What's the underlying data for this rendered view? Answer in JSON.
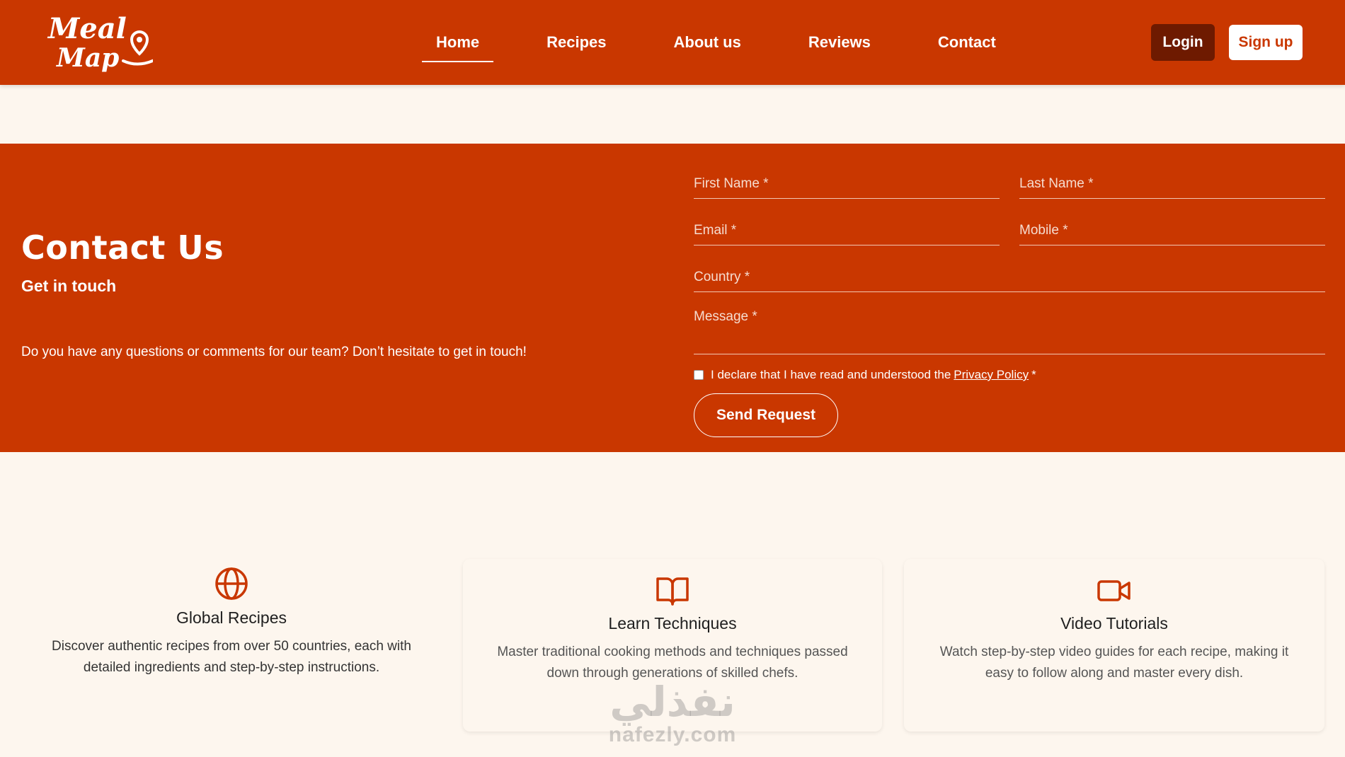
{
  "brand": {
    "logo_line1": "Meal",
    "logo_line2": "Map",
    "accent": "#c93700",
    "dark_accent": "#6e1a00",
    "background": "#fdf6ee"
  },
  "nav": {
    "items": [
      {
        "label": "Home",
        "active": true
      },
      {
        "label": "Recipes",
        "active": false
      },
      {
        "label": "About us",
        "active": false
      },
      {
        "label": "Reviews",
        "active": false
      },
      {
        "label": "Contact",
        "active": false
      }
    ],
    "login_label": "Login",
    "signup_label": "Sign up"
  },
  "contact": {
    "title": "Contact Us",
    "subtitle": "Get in touch",
    "description": "Do you have any questions or comments for our team? Don’t hesitate to get in touch!",
    "form": {
      "first_name": "First Name *",
      "last_name": "Last Name *",
      "email": "Email *",
      "mobile": "Mobile *",
      "country": "Country *",
      "message": "Message *",
      "declare_text": "I declare that I have read and understood the",
      "privacy_link": "Privacy Policy",
      "declare_suffix": "*",
      "send_label": "Send Request"
    }
  },
  "features": [
    {
      "icon": "globe-icon",
      "title": "Global Recipes",
      "text": "Discover authentic recipes from over 50 countries, each with detailed ingredients and step-by-step instructions."
    },
    {
      "icon": "book-icon",
      "title": "Learn Techniques",
      "text": "Master traditional cooking methods and techniques passed down through generations of skilled chefs."
    },
    {
      "icon": "video-icon",
      "title": "Video Tutorials",
      "text": "Watch step-by-step video guides for each recipe, making it easy to follow along and master every dish."
    }
  ],
  "watermark": {
    "arabic": "نفذلي",
    "latin": "nafezly.com"
  }
}
